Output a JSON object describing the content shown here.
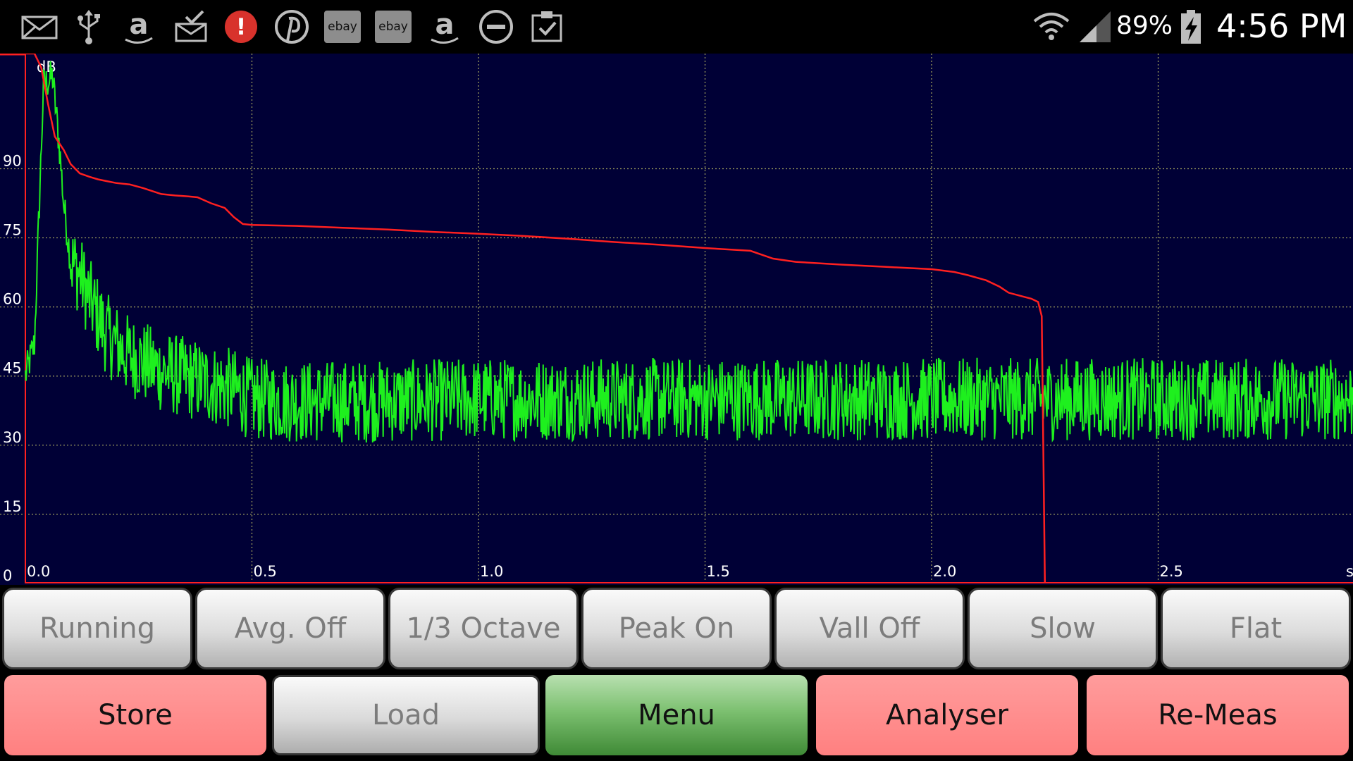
{
  "status_bar": {
    "battery_percent": "89%",
    "clock": "4:56 PM",
    "ebay_label": "ebay",
    "amazon_glyph": "a",
    "alert_glyph": "!",
    "left_icons": [
      "mail-icon",
      "usb-icon",
      "amazon-icon",
      "inbox-download-icon",
      "alert-icon",
      "pinterest-icon",
      "ebay-icon",
      "ebay-icon",
      "amazon-icon",
      "do-not-disturb-icon",
      "clipboard-check-icon"
    ],
    "right_icons": [
      "wifi-icon",
      "signal-icon",
      "battery-charging-icon"
    ]
  },
  "chart_data": {
    "type": "line",
    "ylabel": "dB",
    "xlabel": "s",
    "xlim": [
      0.0,
      2.93
    ],
    "ylim": [
      0,
      115
    ],
    "y_ticks": [
      "0",
      "15",
      "30",
      "45",
      "60",
      "75",
      "90"
    ],
    "y_tick_values": [
      0,
      15,
      30,
      45,
      60,
      75,
      90
    ],
    "x_ticks": [
      "0.0",
      "0.5",
      "1.0",
      "1.5",
      "2.0",
      "2.5"
    ],
    "x_tick_values": [
      0.0,
      0.5,
      1.0,
      1.5,
      2.0,
      2.5
    ],
    "grid": true,
    "background": "#000036",
    "series": [
      {
        "color": "#ff2020",
        "x": [
          0.0,
          0.012,
          0.02,
          0.035,
          0.05,
          0.065,
          0.085,
          0.1,
          0.12,
          0.14,
          0.16,
          0.18,
          0.2,
          0.23,
          0.26,
          0.3,
          0.33,
          0.36,
          0.38,
          0.41,
          0.44,
          0.46,
          0.48,
          0.5,
          0.6,
          0.7,
          0.8,
          0.9,
          1.0,
          1.1,
          1.2,
          1.3,
          1.4,
          1.5,
          1.6,
          1.65,
          1.7,
          1.8,
          1.9,
          2.0,
          2.05,
          2.08,
          2.12,
          2.15,
          2.17,
          2.2,
          2.22,
          2.235,
          2.243,
          2.25
        ],
        "y": [
          115,
          115,
          115,
          112,
          104,
          97,
          94,
          91,
          89,
          88.3,
          87.7,
          87.3,
          86.9,
          86.6,
          85.8,
          84.5,
          84.2,
          84,
          83.8,
          82.5,
          81.5,
          79.5,
          78,
          77.8,
          77.6,
          77.2,
          76.8,
          76.3,
          75.9,
          75.4,
          74.8,
          74.1,
          73.5,
          72.8,
          72.2,
          70.5,
          69.8,
          69.2,
          68.7,
          68.2,
          67.6,
          66.9,
          65.8,
          64.4,
          63.1,
          62.3,
          61.8,
          61.1,
          58,
          0
        ]
      },
      {
        "color": "#1ef01e",
        "x": [
          0.0,
          0.02,
          0.04,
          0.06,
          0.075,
          0.085,
          0.1,
          0.12,
          0.14,
          0.16,
          0.18,
          0.2,
          0.22,
          0.24,
          0.26,
          0.28,
          0.3,
          0.32,
          0.34,
          0.36,
          0.38,
          0.4,
          0.42,
          0.44,
          0.46,
          0.48,
          0.5,
          0.6,
          0.8,
          1.0,
          1.2,
          1.4,
          1.6,
          1.8,
          2.0,
          2.2,
          2.4,
          2.6,
          2.8,
          2.93
        ],
        "y": [
          45,
          52,
          108,
          110,
          95,
          82,
          70,
          67,
          62,
          58,
          54,
          52,
          50,
          49,
          48,
          47,
          46,
          45.5,
          45,
          44.5,
          44,
          43.5,
          43,
          42.5,
          42,
          41,
          40,
          39.5,
          39.5,
          40,
          40,
          40,
          40,
          40,
          40,
          40,
          40,
          40,
          40,
          40
        ]
      }
    ]
  },
  "row1": [
    "Running",
    "Avg. Off",
    "1/3 Octave",
    "Peak On",
    "Vall Off",
    "Slow",
    "Flat"
  ],
  "row2": [
    "Store",
    "Load",
    "Menu",
    "Analyser",
    "Re-Meas"
  ]
}
